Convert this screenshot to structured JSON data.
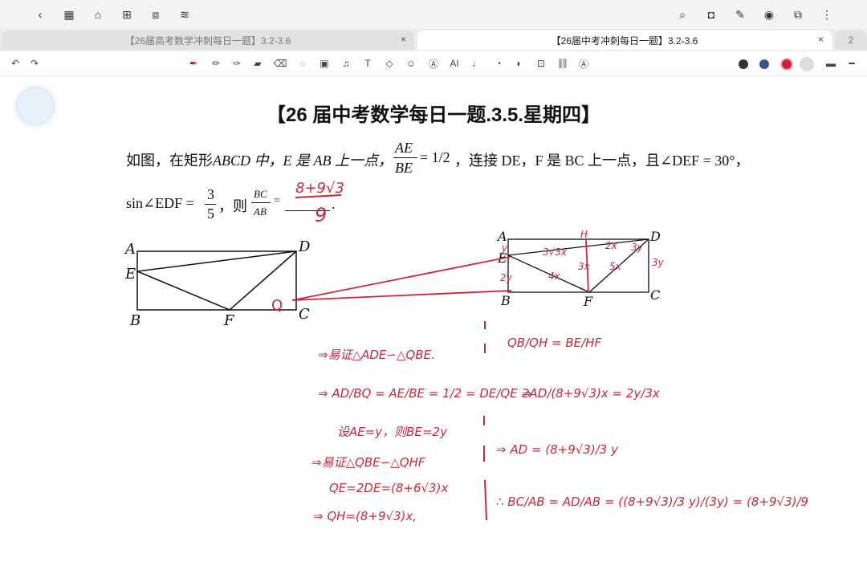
{
  "browser": {
    "tabs": [
      {
        "label": "【26届高考数学冲刺每日一题】3.2-3.6"
      },
      {
        "label": "【26届中考冲刺每日一题】3.2-3.6"
      },
      {
        "label": "2"
      }
    ]
  },
  "toolbar": {
    "ai_label": "AI"
  },
  "note": {
    "title": "【26 届中考数学每日一题.3.5.星期四】",
    "problem_line1_prefix": "如图，在矩形",
    "problem_line1_text": "ABCD 中，E 是 AB 上一点，",
    "frac1_num": "AE",
    "frac1_den": "BE",
    "eq_one_half": "= 1/2",
    "line1_tail": "，连接 DE，F 是 BC 上一点，且∠DEF = 30°，",
    "line2_sin": "sin∠EDF =",
    "frac_3_5_num": "3",
    "frac_3_5_den": "5",
    "line2_then": "，则",
    "frac2_num": "BC",
    "frac2_den": "AB",
    "line2_eq": "=",
    "line2_dot": ".",
    "answer_top": "8+9√3",
    "answer_bottom": "9"
  },
  "figure_left": {
    "labels": {
      "A": "A",
      "B": "B",
      "C": "C",
      "D": "D",
      "E": "E",
      "F": "F",
      "Q": "Q"
    }
  },
  "figure_right": {
    "labels": {
      "A": "A",
      "B": "B",
      "C": "C",
      "D": "D",
      "E": "E",
      "F": "F",
      "H": "H"
    },
    "annotations": [
      "3√3x",
      "3x",
      "4x",
      "2x",
      "5x",
      "y",
      "2y",
      "3y",
      "3y"
    ]
  },
  "handwriting": {
    "left_lines": [
      "⇒易证△ADE∽△QBE.",
      "⇒ AD/BQ = AE/BE = 1/2 = DE/QE ⇒",
      "设AE=y，则BE=2y",
      "⇒易证△QBE∽△QHF",
      "QE=2DE=(8+6√3)x",
      "⇒ QH=(8+9√3)x,"
    ],
    "right_lines": [
      "QB/QH = BE/HF",
      "2AD/(8+9√3)x = 2y/3x",
      "⇒ AD = (8+9√3)/3 y",
      "∴ BC/AB = AD/AB = ((8+9√3)/3 y)/(3y) = (8+9√3)/9"
    ]
  }
}
